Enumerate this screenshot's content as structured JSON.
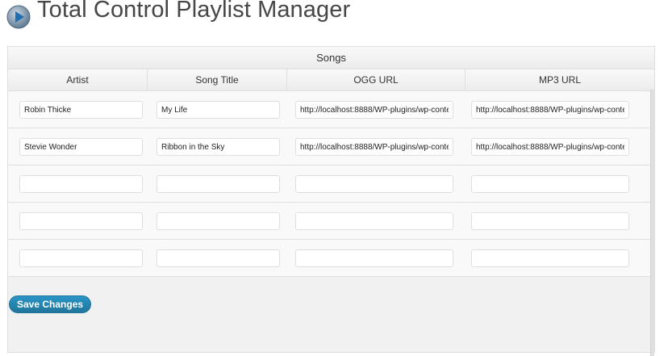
{
  "page": {
    "title": "Total Control Playlist Manager",
    "icon": "play-icon"
  },
  "table": {
    "caption": "Songs",
    "columns": [
      "Artist",
      "Song Title",
      "OGG URL",
      "MP3 URL"
    ],
    "rows": [
      {
        "artist": "Robin Thicke",
        "title": "My Life",
        "ogg": "http://localhost:8888/WP-plugins/wp-content",
        "mp3": "http://localhost:8888/WP-plugins/wp-content"
      },
      {
        "artist": "Stevie Wonder",
        "title": "Ribbon in the Sky",
        "ogg": "http://localhost:8888/WP-plugins/wp-content",
        "mp3": "http://localhost:8888/WP-plugins/wp-content"
      },
      {
        "artist": "",
        "title": "",
        "ogg": "",
        "mp3": ""
      },
      {
        "artist": "",
        "title": "",
        "ogg": "",
        "mp3": ""
      },
      {
        "artist": "",
        "title": "",
        "ogg": "",
        "mp3": ""
      }
    ]
  },
  "actions": {
    "save_label": "Save Changes"
  },
  "colors": {
    "accent": "#21759b",
    "title_text": "#464646"
  }
}
